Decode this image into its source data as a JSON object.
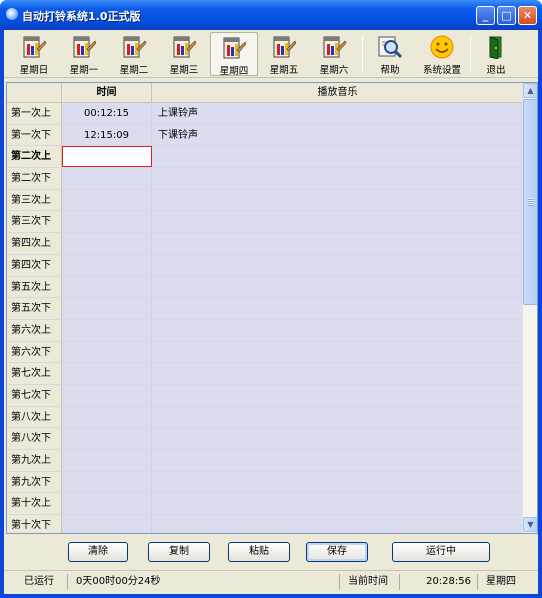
{
  "window": {
    "title": "自动打铃系统1.0正式版"
  },
  "titlebar_buttons": {
    "minimize": "_",
    "maximize": "□",
    "close": "✕"
  },
  "toolbar": [
    {
      "label": "星期日",
      "icon": "calendar-day-icon"
    },
    {
      "label": "星期一",
      "icon": "calendar-day-icon"
    },
    {
      "label": "星期二",
      "icon": "calendar-day-icon"
    },
    {
      "label": "星期三",
      "icon": "calendar-day-icon"
    },
    {
      "label": "星期四",
      "icon": "calendar-day-icon",
      "active": true
    },
    {
      "label": "星期五",
      "icon": "calendar-day-icon"
    },
    {
      "label": "星期六",
      "icon": "calendar-day-icon"
    },
    {
      "label": "帮助",
      "icon": "help-magnifier-icon"
    },
    {
      "label": "系统设置",
      "icon": "smiley-settings-icon"
    },
    {
      "label": "退出",
      "icon": "exit-door-icon"
    }
  ],
  "grid": {
    "headers": {
      "row_header": "",
      "time": "时间",
      "music": "播放音乐"
    },
    "rows": [
      {
        "label": "第一次上",
        "time": "00:12:15",
        "music": "上课铃声"
      },
      {
        "label": "第一次下",
        "time": "12:15:09",
        "music": "下课铃声"
      },
      {
        "label": "第二次上",
        "time": "",
        "music": "",
        "current": true
      },
      {
        "label": "第二次下",
        "time": "",
        "music": ""
      },
      {
        "label": "第三次上",
        "time": "",
        "music": ""
      },
      {
        "label": "第三次下",
        "time": "",
        "music": ""
      },
      {
        "label": "第四次上",
        "time": "",
        "music": ""
      },
      {
        "label": "第四次下",
        "time": "",
        "music": ""
      },
      {
        "label": "第五次上",
        "time": "",
        "music": ""
      },
      {
        "label": "第五次下",
        "time": "",
        "music": ""
      },
      {
        "label": "第六次上",
        "time": "",
        "music": ""
      },
      {
        "label": "第六次下",
        "time": "",
        "music": ""
      },
      {
        "label": "第七次上",
        "time": "",
        "music": ""
      },
      {
        "label": "第七次下",
        "time": "",
        "music": ""
      },
      {
        "label": "第八次上",
        "time": "",
        "music": ""
      },
      {
        "label": "第八次下",
        "time": "",
        "music": ""
      },
      {
        "label": "第九次上",
        "time": "",
        "music": ""
      },
      {
        "label": "第九次下",
        "time": "",
        "music": ""
      },
      {
        "label": "第十次上",
        "time": "",
        "music": ""
      },
      {
        "label": "第十次下",
        "time": "",
        "music": ""
      }
    ]
  },
  "buttons": {
    "clear": "清除",
    "copy": "复制",
    "paste": "粘贴",
    "save": "保存",
    "running": "运行中"
  },
  "status": {
    "state": "已运行",
    "uptime": "0天00时00分24秒",
    "current_time_label": "当前时间",
    "current_time": "20:28:56",
    "weekday": "星期四"
  }
}
